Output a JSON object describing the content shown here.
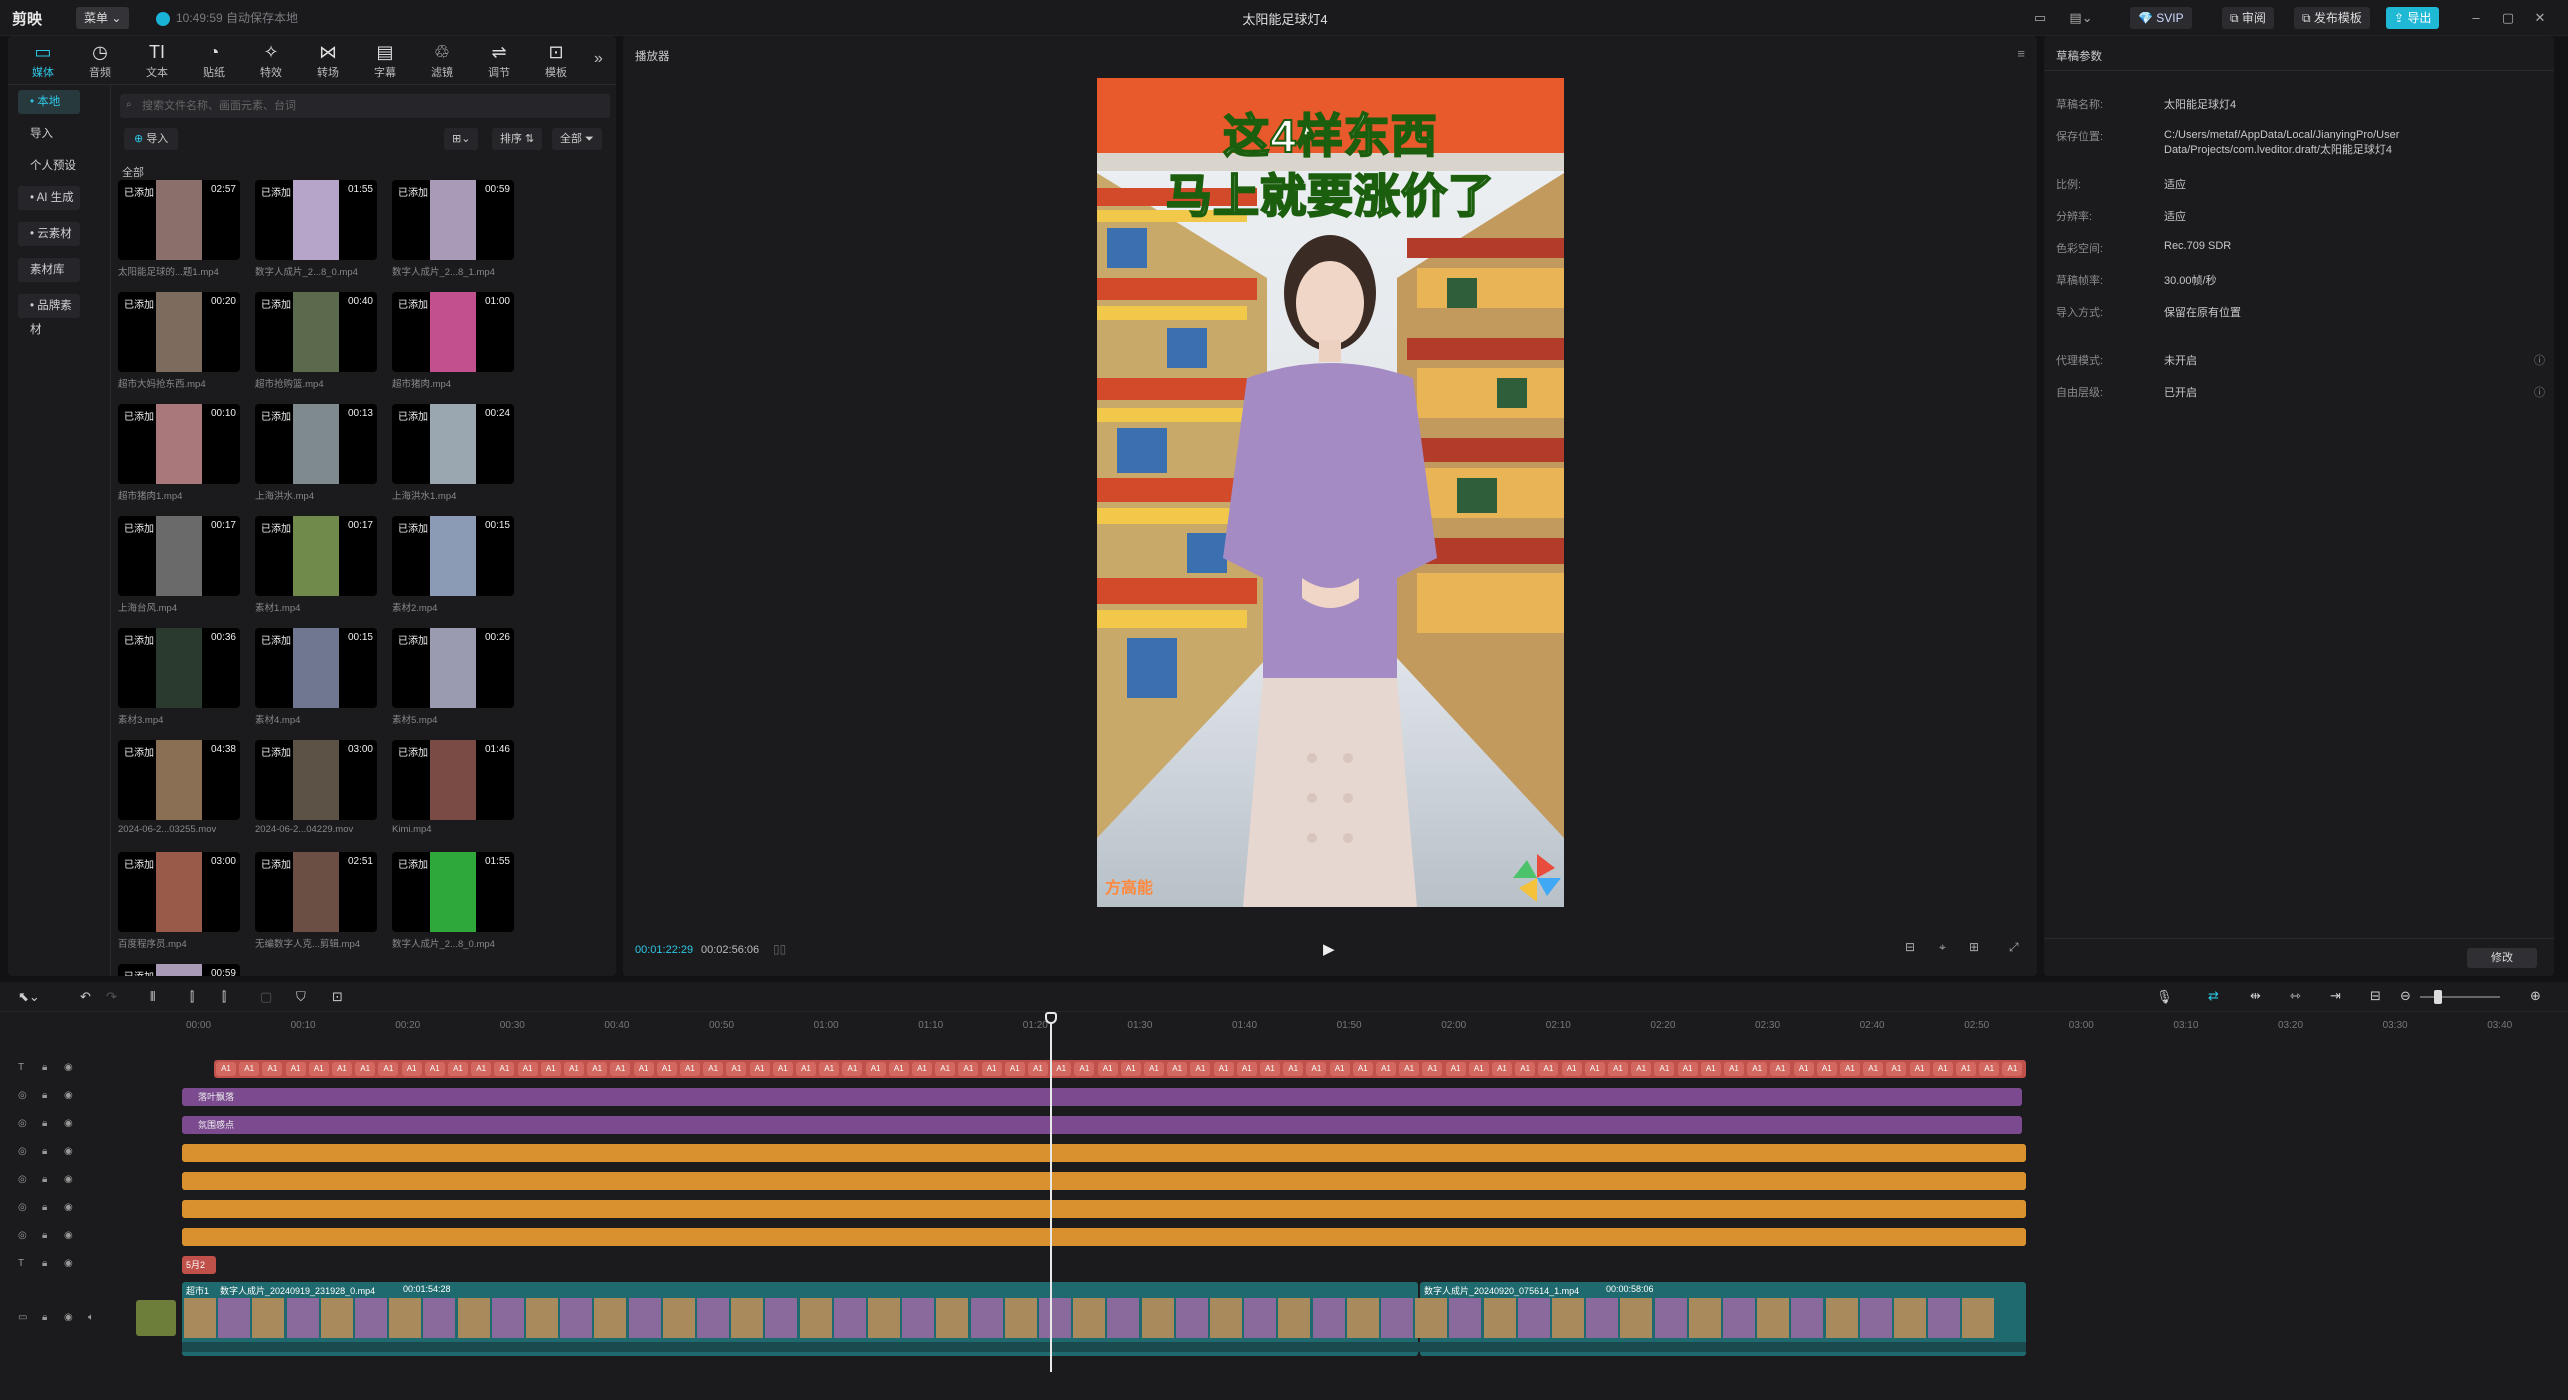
{
  "app": {
    "logo": "剪映",
    "menu": "菜单",
    "autosave": "10:49:59 自动保存本地",
    "project_title": "太阳能足球灯4",
    "svip": "SVIP",
    "review": "审阅",
    "publish_template": "发布模板",
    "export": "导出"
  },
  "toolbar": [
    {
      "icon": "media-icon",
      "label": "媒体",
      "glyph": "▭"
    },
    {
      "icon": "audio-icon",
      "label": "音频",
      "glyph": "◷"
    },
    {
      "icon": "text-icon",
      "label": "文本",
      "glyph": "TI"
    },
    {
      "icon": "sticker-icon",
      "label": "贴纸",
      "glyph": "◔"
    },
    {
      "icon": "effects-icon",
      "label": "特效",
      "glyph": "✧"
    },
    {
      "icon": "transition-icon",
      "label": "转场",
      "glyph": "⋈"
    },
    {
      "icon": "caption-icon",
      "label": "字幕",
      "glyph": "▤"
    },
    {
      "icon": "filter-icon",
      "label": "滤镜",
      "glyph": "♲"
    },
    {
      "icon": "adjust-icon",
      "label": "调节",
      "glyph": "⇌"
    },
    {
      "icon": "template-icon",
      "label": "模板",
      "glyph": "⊡"
    }
  ],
  "sidenav": [
    {
      "label": "• 本地",
      "active": true
    },
    {
      "label": "导入"
    },
    {
      "label": "个人预设"
    },
    {
      "label": "• AI 生成",
      "boxed": true
    },
    {
      "label": "• 云素材",
      "boxed": true
    },
    {
      "label": "素材库",
      "boxed": true
    },
    {
      "label": "• 品牌素材",
      "boxed": true
    }
  ],
  "search": {
    "placeholder": "搜索文件名称、画面元素、台词"
  },
  "import_button": "导入",
  "sort_label": "排序",
  "filter_label": "全部",
  "section_all": "全部",
  "added_badge": "已添加",
  "media_items": [
    {
      "dur": "02:57",
      "name": "太阳能足球的...题1.mp4",
      "color": "#8a6f6a"
    },
    {
      "dur": "01:55",
      "name": "数字人成片_2...8_0.mp4",
      "color": "#b7a4c9"
    },
    {
      "dur": "00:59",
      "name": "数字人成片_2...8_1.mp4",
      "color": "#a99ab8"
    },
    {
      "dur": "00:20",
      "name": "超市大妈抢东西.mp4",
      "color": "#7d6b5e"
    },
    {
      "dur": "00:40",
      "name": "超市抢购篮.mp4",
      "color": "#5b6a4c"
    },
    {
      "dur": "01:00",
      "name": "超市猪肉.mp4",
      "color": "#c2508f"
    },
    {
      "dur": "00:10",
      "name": "超市猪肉1.mp4",
      "color": "#a8787a"
    },
    {
      "dur": "00:13",
      "name": "上海洪水.mp4",
      "color": "#7f8a8e"
    },
    {
      "dur": "00:24",
      "name": "上海洪水1.mp4",
      "color": "#9aa7b1"
    },
    {
      "dur": "00:17",
      "name": "上海台风.mp4",
      "color": "#6a6a6a"
    },
    {
      "dur": "00:17",
      "name": "素材1.mp4",
      "color": "#6f8a4b"
    },
    {
      "dur": "00:15",
      "name": "素材2.mp4",
      "color": "#8c9bb5"
    },
    {
      "dur": "00:36",
      "name": "素材3.mp4",
      "color": "#2b3a2e"
    },
    {
      "dur": "00:15",
      "name": "素材4.mp4",
      "color": "#6f7890"
    },
    {
      "dur": "00:26",
      "name": "素材5.mp4",
      "color": "#9a9bb0"
    },
    {
      "dur": "04:38",
      "name": "2024-06-2...03255.mov",
      "color": "#8b6f55"
    },
    {
      "dur": "03:00",
      "name": "2024-06-2...04229.mov",
      "color": "#5d5246"
    },
    {
      "dur": "01:46",
      "name": "Kimi.mp4",
      "color": "#7a4b45"
    },
    {
      "dur": "03:00",
      "name": "百度程序员.mp4",
      "color": "#9a5a4a"
    },
    {
      "dur": "02:51",
      "name": "无编数字人克...剪辑.mp4",
      "color": "#6b4e44"
    },
    {
      "dur": "01:55",
      "name": "数字人成片_2...8_0.mp4",
      "color": "#2ea83a"
    },
    {
      "dur": "00:59",
      "name": "",
      "color": "#a99ab8"
    }
  ],
  "player": {
    "title": "播放器",
    "time_current": "00:01:22:29",
    "time_total": "00:02:56:06",
    "video_line1": "这4样东西",
    "video_line2": "马上就要涨价了",
    "watermark": "方高能"
  },
  "params": {
    "title": "草稿参数",
    "rows": [
      {
        "label": "草稿名称:",
        "value": "太阳能足球灯4"
      },
      {
        "label": "保存位置:",
        "value": "C:/Users/metaf/AppData/Local/JianyingPro/User Data/Projects/com.lveditor.draft/太阳能足球灯4"
      },
      {
        "label": "比例:",
        "value": "适应"
      },
      {
        "label": "分辨率:",
        "value": "适应"
      },
      {
        "label": "色彩空间:",
        "value": "Rec.709 SDR"
      },
      {
        "label": "草稿帧率:",
        "value": "30.00帧/秒"
      },
      {
        "label": "导入方式:",
        "value": "保留在原有位置"
      },
      {
        "label": "代理模式:",
        "value": "未开启"
      },
      {
        "label": "自由层级:",
        "value": "已开启"
      }
    ],
    "modify": "修改"
  },
  "ruler": [
    "00:00",
    "00:10",
    "00:20",
    "00:30",
    "00:40",
    "00:50",
    "01:00",
    "01:10",
    "01:20",
    "01:30",
    "01:40",
    "01:50",
    "02:00",
    "02:10",
    "02:20",
    "02:30",
    "02:40",
    "02:50",
    "03:00",
    "03:10",
    "03:20",
    "03:30",
    "03:40"
  ],
  "tracks": {
    "effect1": "落叶飘落",
    "effect2": "氛围感点",
    "text_clip": "5月2",
    "main_clip1_label": "超市1",
    "main_clip1_name": "数字人成片_20240919_231928_0.mp4",
    "main_clip1_dur": "00:01:54:28",
    "main_clip2_name": "数字人成片_20240920_075614_1.mp4",
    "main_clip2_dur": "00:00:58:06",
    "caption_chip": "A1"
  },
  "colors": {
    "accent": "#2ec8e6",
    "caption": "#c0504a",
    "effect": "#7b4a8f",
    "sticker": "#d8912e",
    "main": "#1f6a6e"
  }
}
